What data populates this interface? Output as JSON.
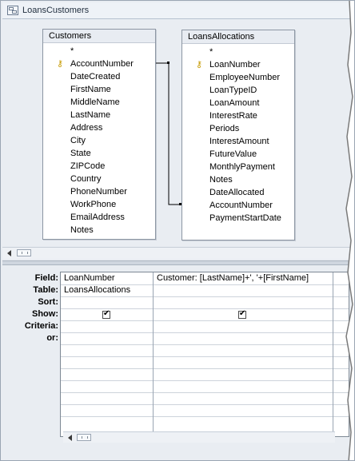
{
  "window": {
    "tab_title": "LoansCustomers",
    "tab_icon": "query-icon"
  },
  "tables": [
    {
      "name": "Customers",
      "fields": [
        "*",
        "AccountNumber",
        "DateCreated",
        "FirstName",
        "MiddleName",
        "LastName",
        "Address",
        "City",
        "State",
        "ZIPCode",
        "Country",
        "PhoneNumber",
        "WorkPhone",
        "EmailAddress",
        "Notes"
      ],
      "primary_key": "AccountNumber"
    },
    {
      "name": "LoansAllocations",
      "fields": [
        "*",
        "LoanNumber",
        "EmployeeNumber",
        "LoanTypeID",
        "LoanAmount",
        "InterestRate",
        "Periods",
        "InterestAmount",
        "FutureValue",
        "MonthlyPayment",
        "Notes",
        "DateAllocated",
        "AccountNumber",
        "PaymentStartDate"
      ],
      "primary_key": "LoanNumber"
    }
  ],
  "grid": {
    "row_labels": [
      "Field:",
      "Table:",
      "Sort:",
      "Show:",
      "Criteria:",
      "or:"
    ],
    "columns": [
      {
        "field": "LoanNumber",
        "table": "LoansAllocations",
        "sort": "",
        "show": true
      },
      {
        "field": "Customer: [LastName]+', '+[FirstName]",
        "table": "",
        "sort": "",
        "show": true
      }
    ]
  }
}
